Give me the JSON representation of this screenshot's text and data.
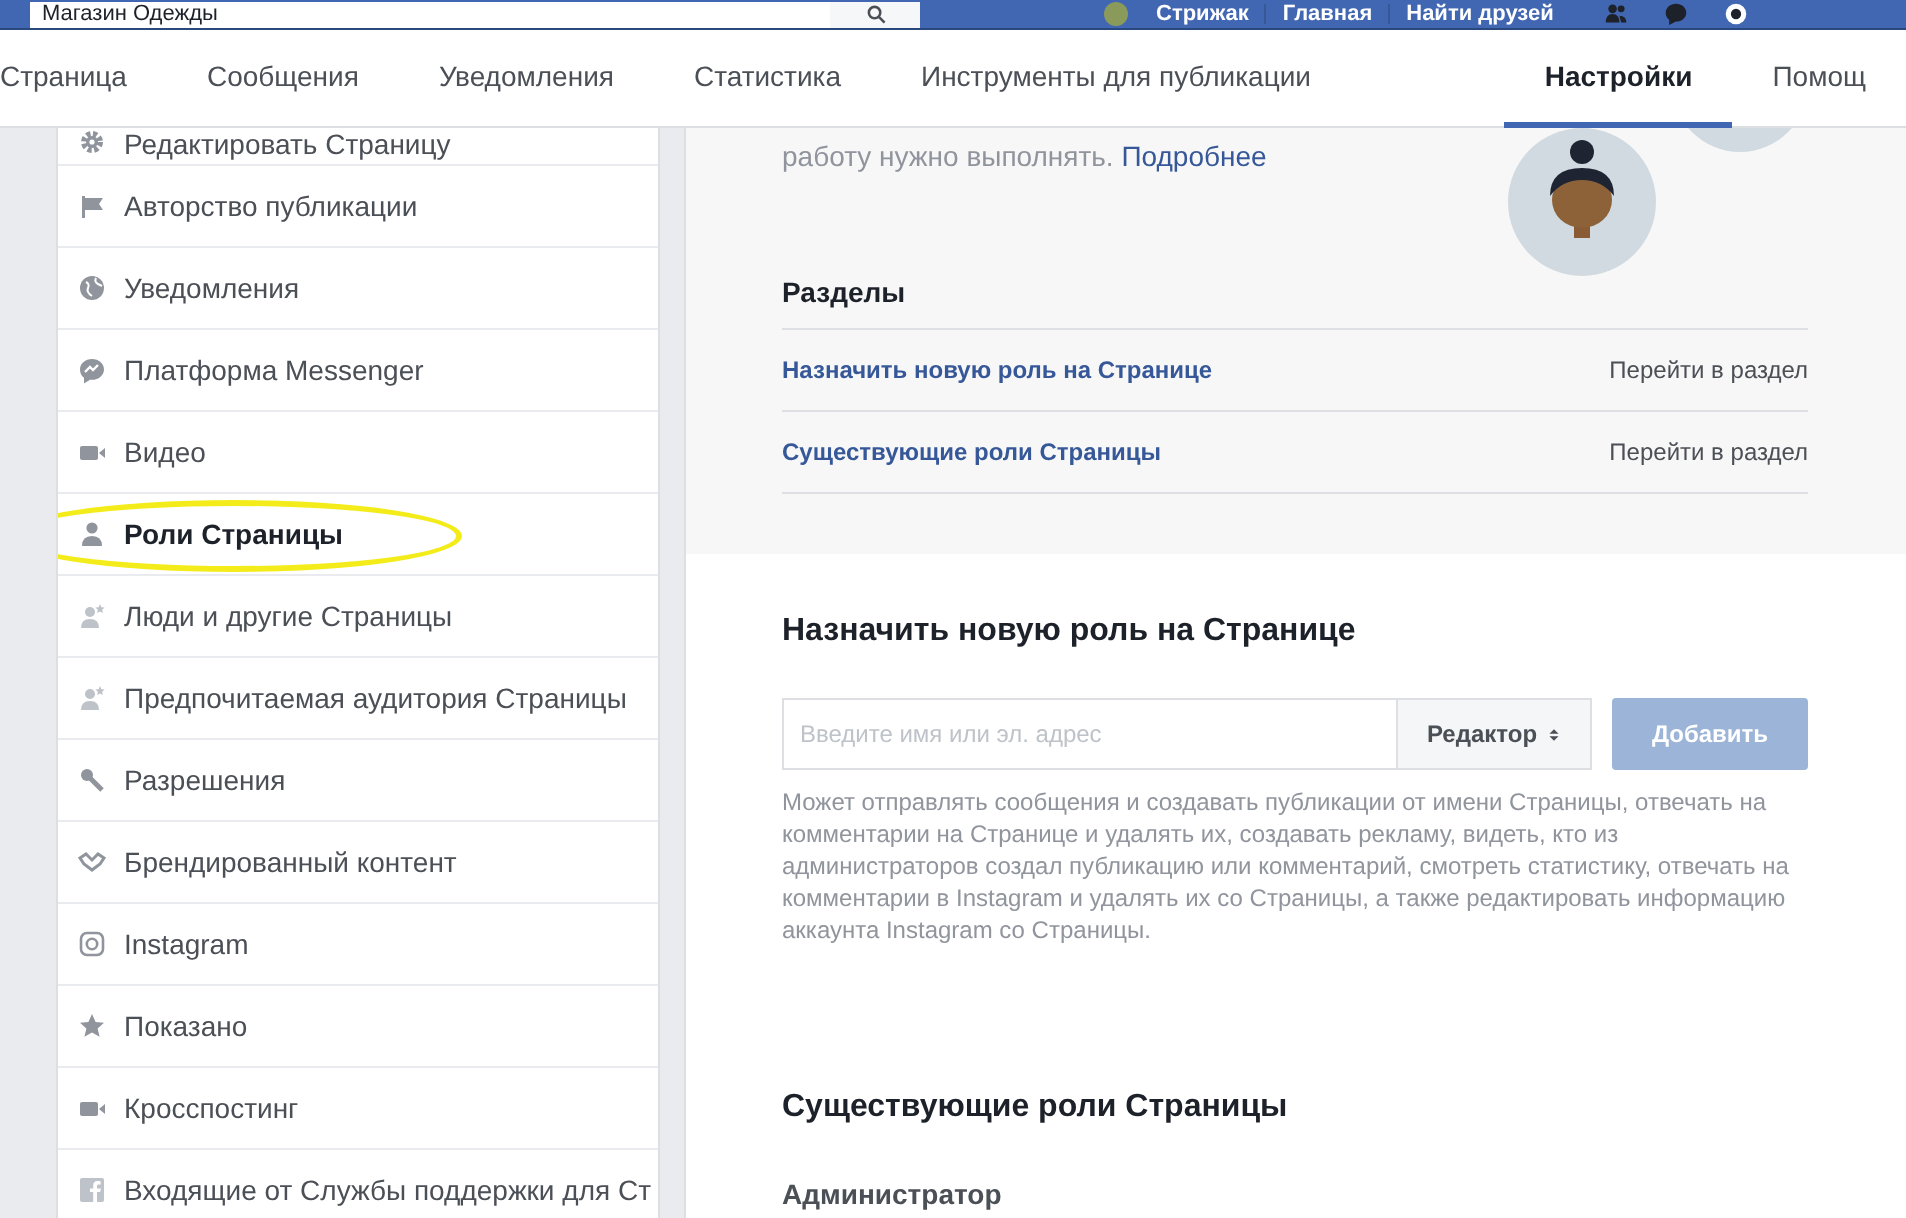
{
  "top_bar": {
    "search": {
      "value": "Магазин Одежды"
    },
    "links": [
      "Стрижак",
      "Главная",
      "Найти друзей"
    ]
  },
  "tabs": [
    {
      "label": "Страница",
      "selected": false
    },
    {
      "label": "Сообщения",
      "selected": false
    },
    {
      "label": "Уведомления",
      "selected": false
    },
    {
      "label": "Статистика",
      "selected": false
    },
    {
      "label": "Инструменты для публикации",
      "selected": false
    },
    {
      "label": "Настройки",
      "selected": true
    },
    {
      "label": "Помощ",
      "selected": false
    }
  ],
  "sidebar": {
    "items": [
      {
        "label": "Редактировать Страницу",
        "selected": false,
        "highlighted": false
      },
      {
        "label": "Авторство публикации",
        "selected": false,
        "highlighted": false
      },
      {
        "label": "Уведомления",
        "selected": false,
        "highlighted": false
      },
      {
        "label": "Платформа Messenger",
        "selected": false,
        "highlighted": false
      },
      {
        "label": "Видео",
        "selected": false,
        "highlighted": false
      },
      {
        "label": "Роли Страницы",
        "selected": true,
        "highlighted": true
      },
      {
        "label": "Люди и другие Страницы",
        "selected": false,
        "highlighted": false
      },
      {
        "label": "Предпочитаемая аудитория Страницы",
        "selected": false,
        "highlighted": false
      },
      {
        "label": "Разрешения",
        "selected": false,
        "highlighted": false
      },
      {
        "label": "Брендированный контент",
        "selected": false,
        "highlighted": false
      },
      {
        "label": "Instagram",
        "selected": false,
        "highlighted": false
      },
      {
        "label": "Показано",
        "selected": false,
        "highlighted": false
      },
      {
        "label": "Кросспостинг",
        "selected": false,
        "highlighted": false
      },
      {
        "label": "Входящие от Службы поддержки для Ст",
        "selected": false,
        "highlighted": false
      }
    ]
  },
  "roles_intro": {
    "text": "работу нужно выполнять.",
    "link": "Подробнее"
  },
  "sections": {
    "title": "Разделы",
    "rows": [
      {
        "label": "Назначить новую роль на Странице",
        "action": "Перейти в раздел"
      },
      {
        "label": "Существующие роли Страницы",
        "action": "Перейти в раздел"
      }
    ]
  },
  "assign_role": {
    "title": "Назначить новую роль на Странице",
    "input": {
      "placeholder": "Введите имя или эл. адрес"
    },
    "role_select": {
      "value": "Редактор"
    },
    "add_button": {
      "label": "Добавить",
      "disabled": true
    },
    "description": "Может отправлять сообщения и создавать публикации от имени Страницы, отвечать на комментарии на Странице и удалять их, создавать рекламу, видеть, кто из администраторов создал публикацию или комментарий, смотреть статистику, отвечать на комментарии в Instagram и удалять их со Страницы, а также редактировать информацию аккаунта Instagram со Страницы."
  },
  "existing_roles": {
    "title": "Существующие роли Страницы",
    "subtitle": "Администратор"
  }
}
